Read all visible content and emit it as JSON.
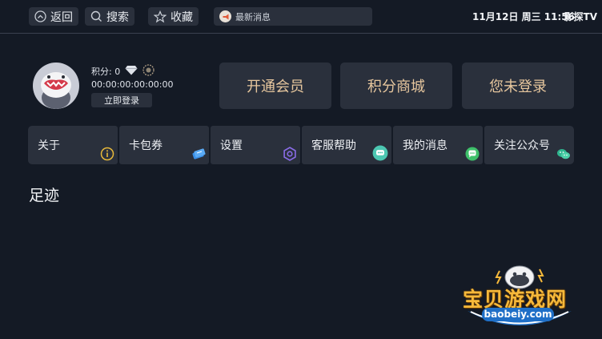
{
  "topbar": {
    "back_label": "返回",
    "search_label": "搜索",
    "favorites_label": "收藏",
    "news_label": "最新消息",
    "datetime": "11月12日 周三 11:56",
    "brand": "影探TV"
  },
  "profile": {
    "points": "积分: 0",
    "device_id": "00:00:00:00:00:00",
    "login_label": "立即登录"
  },
  "actions": {
    "vip_label": "开通会员",
    "store_label": "积分商城",
    "status_label": "您未登录"
  },
  "menu": {
    "items": [
      {
        "label": "关于",
        "icon": "info-icon"
      },
      {
        "label": "卡包券",
        "icon": "coupon-icon"
      },
      {
        "label": "设置",
        "icon": "settings-icon"
      },
      {
        "label": "客服帮助",
        "icon": "help-chat-icon"
      },
      {
        "label": "我的消息",
        "icon": "message-icon"
      },
      {
        "label": "关注公众号",
        "icon": "wechat-icon"
      }
    ]
  },
  "history": {
    "title": "足迹"
  },
  "watermark": {
    "title": "宝贝游戏网",
    "url": "baobeiy.com"
  },
  "colors": {
    "background": "#141a25",
    "panel": "#2a303c",
    "accent_gold": "#e7c79e",
    "watermark_orange": "#f6b93b"
  }
}
